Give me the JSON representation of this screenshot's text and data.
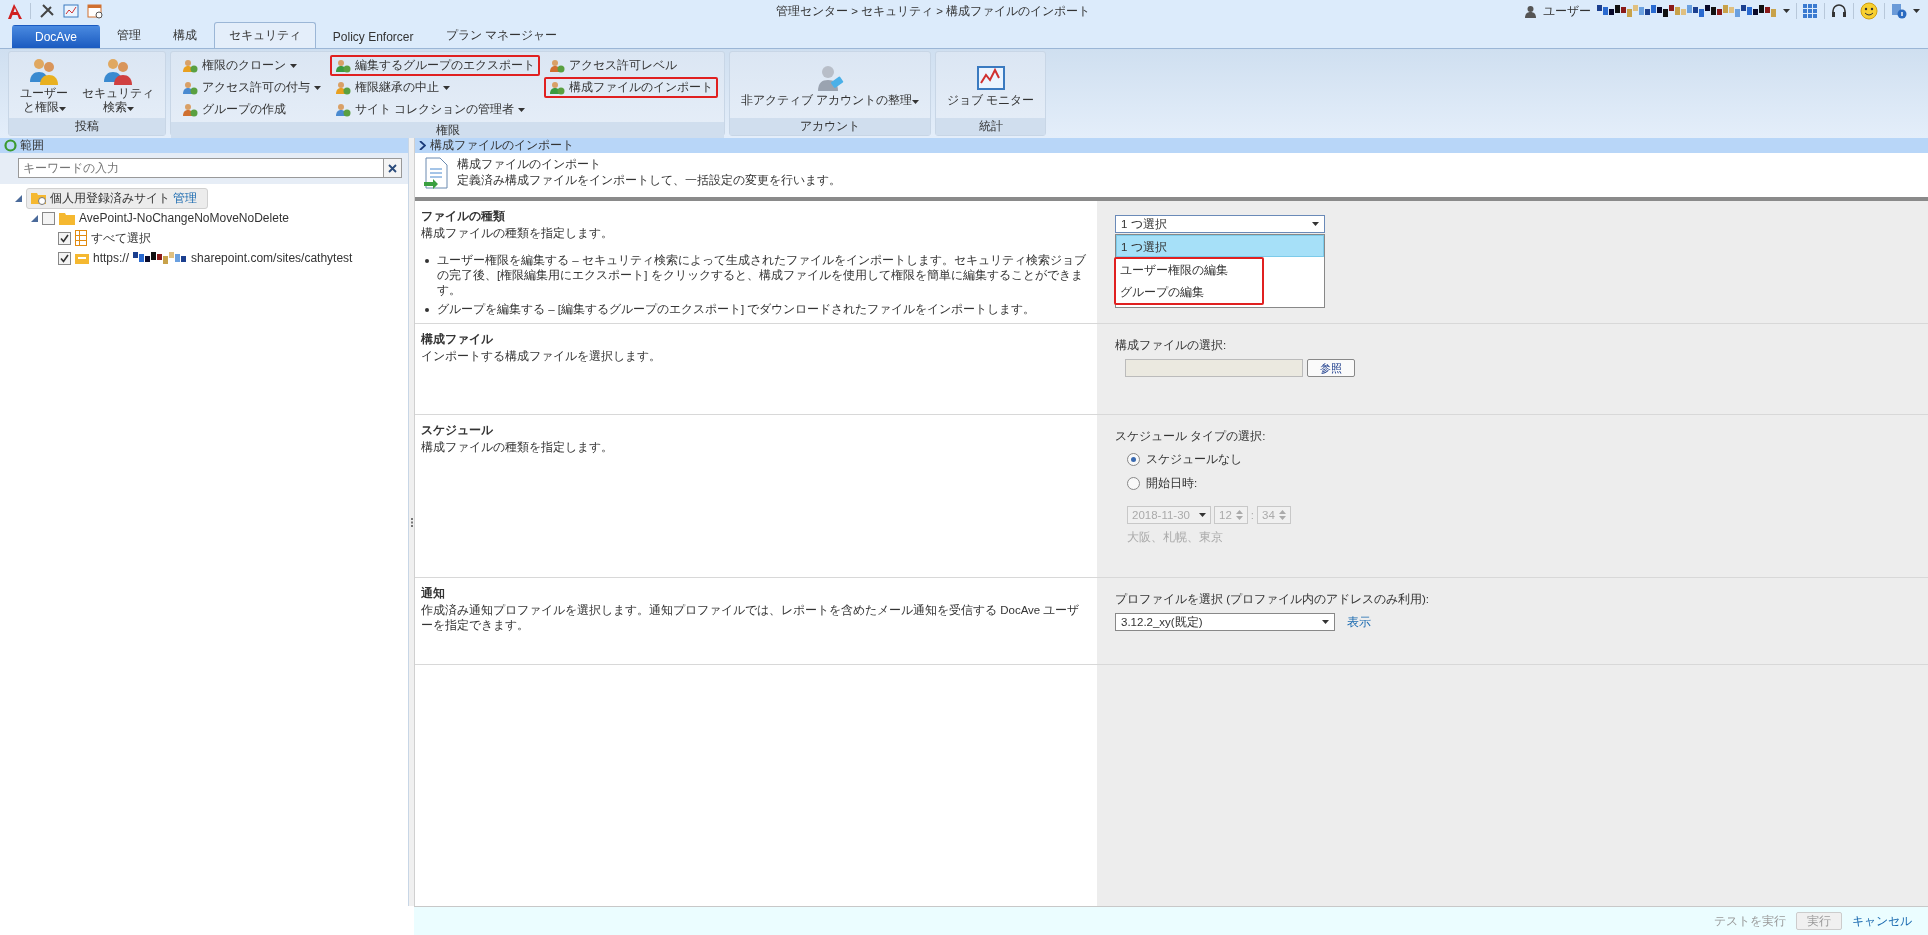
{
  "top_bar": {
    "breadcrumb": "管理センター > セキュリティ > 構成ファイルのインポート",
    "user_label": "ユーザー"
  },
  "tabs": [
    {
      "label": "DocAve",
      "kind": "home",
      "selected": false
    },
    {
      "label": "管理",
      "kind": "tab",
      "selected": false
    },
    {
      "label": "構成",
      "kind": "tab",
      "selected": false
    },
    {
      "label": "セキュリティ",
      "kind": "tab",
      "selected": true
    },
    {
      "label": "Policy Enforcer",
      "kind": "tab",
      "selected": false
    },
    {
      "label": "プラン マネージャー",
      "kind": "tab",
      "selected": false
    }
  ],
  "ribbon": {
    "groups": [
      {
        "title": "投稿",
        "kind": "large",
        "buttons": [
          {
            "lines": [
              "ユーザー",
              "と権限"
            ],
            "dropdown": true,
            "highlighted": false
          },
          {
            "lines": [
              "セキュリティ",
              "検索"
            ],
            "dropdown": true,
            "highlighted": false
          }
        ]
      },
      {
        "title": "権限",
        "kind": "small",
        "columns": [
          [
            {
              "label": "権限のクローン",
              "dropdown": true,
              "highlighted": false
            },
            {
              "label": "アクセス許可の付与",
              "dropdown": true,
              "highlighted": false
            },
            {
              "label": "グループの作成",
              "dropdown": false,
              "highlighted": false
            }
          ],
          [
            {
              "label": "編集するグループのエクスポート",
              "dropdown": false,
              "highlighted": true
            },
            {
              "label": "権限継承の中止",
              "dropdown": true,
              "highlighted": false
            },
            {
              "label": "サイト コレクションの管理者",
              "dropdown": true,
              "highlighted": false
            }
          ],
          [
            {
              "label": "アクセス許可レベル",
              "dropdown": false,
              "highlighted": false
            },
            {
              "label": "構成ファイルのインポート",
              "dropdown": false,
              "highlighted": true
            }
          ]
        ]
      },
      {
        "title": "アカウント",
        "kind": "large",
        "buttons": [
          {
            "lines": [
              "非アクティブ アカウントの整理"
            ],
            "dropdown": true,
            "highlighted": false
          }
        ]
      },
      {
        "title": "統計",
        "kind": "large",
        "buttons": [
          {
            "lines": [
              "ジョブ モニター"
            ],
            "dropdown": false,
            "highlighted": false
          }
        ]
      }
    ]
  },
  "scope": {
    "title": "範囲",
    "search": {
      "placeholder": "キーワードの入力"
    },
    "tree": [
      {
        "label": "個人用登録済みサイト",
        "link": "管理",
        "expanded": true,
        "children": [
          {
            "label": "AvePointJ-NoChangeNoMoveNoDelete",
            "checked": false,
            "expanded": true,
            "children": [
              {
                "label": "すべて選択",
                "checked": true,
                "redacted": false
              },
              {
                "label_start": "https://",
                "label": "sharepoint.com/sites/cathytest",
                "checked": true,
                "redacted": true
              }
            ]
          }
        ]
      }
    ]
  },
  "main": {
    "header": "構成ファイルのインポート",
    "intro": {
      "title": "構成ファイルのインポート",
      "description": "定義済み構成ファイルをインポートして、一括設定の変更を行います。"
    },
    "sections": [
      {
        "kind": "file_type",
        "title": "ファイルの種類",
        "description": "構成ファイルの種類を指定します。",
        "bullets": [
          "ユーザー権限を編集する – セキュリティ検索によって生成されたファイルをインポートします。セキュリティ検索ジョブの完了後、[権限編集用にエクスポート] をクリックすると、構成ファイルを使用して権限を簡単に編集することができます。",
          "グループを編集する – [編集するグループのエクスポート] でダウンロードされたファイルをインポートします。"
        ],
        "select": {
          "value": "1 つ選択",
          "expanded": true,
          "options": [
            {
              "label": "1 つ選択",
              "selected": true,
              "highlighted": false
            },
            {
              "label": "ユーザー権限の編集",
              "selected": false,
              "highlighted": true
            },
            {
              "label": "グループの編集",
              "selected": false,
              "highlighted": true
            }
          ]
        }
      },
      {
        "kind": "file",
        "title": "構成ファイル",
        "description": "インポートする構成ファイルを選択します。",
        "field_label": "構成ファイルの選択:",
        "button": "参照"
      },
      {
        "kind": "schedule",
        "title": "スケジュール",
        "description": "構成ファイルの種類を指定します。",
        "field_label": "スケジュール タイプの選択:",
        "options": [
          {
            "label": "スケジュールなし",
            "selected": true
          },
          {
            "label": "開始日時:",
            "selected": false
          }
        ],
        "date": "2018-11-30",
        "hour": "12",
        "separator": ":",
        "minute": "34",
        "timezone": "大阪、札幌、東京",
        "disabled": true
      },
      {
        "kind": "notify",
        "title": "通知",
        "description": "作成済み通知プロファイルを選択します。通知プロファイルでは、レポートを含めたメール通知を受信する DocAve ユーザーを指定できます。",
        "field_label": "プロファイルを選択 (プロファイル内のアドレスのみ利用):",
        "select": {
          "value": "3.12.2_xy(既定)"
        },
        "link": "表示"
      }
    ]
  },
  "footer": {
    "test": {
      "label": "テストを実行",
      "disabled": true
    },
    "run": {
      "label": "実行",
      "disabled": true
    },
    "cancel": "キャンセル"
  }
}
